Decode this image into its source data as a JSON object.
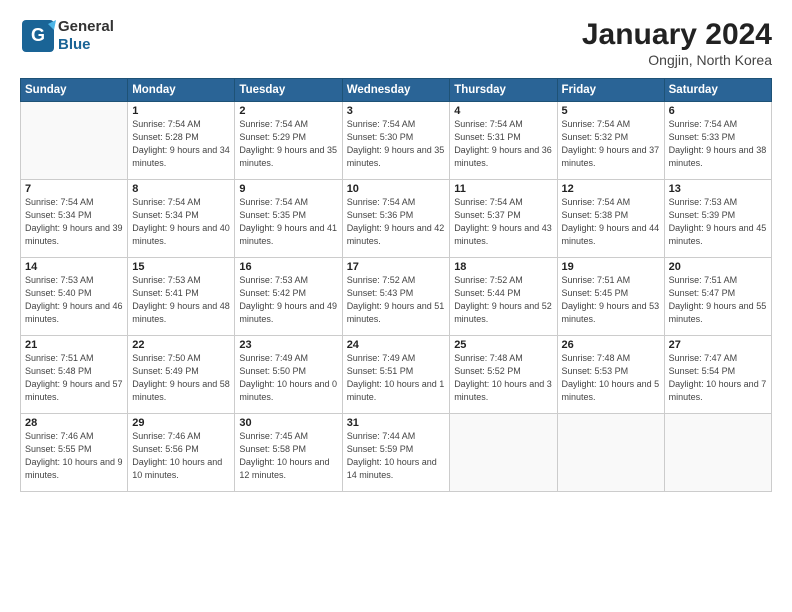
{
  "logo": {
    "general": "General",
    "blue": "Blue"
  },
  "title": {
    "month": "January 2024",
    "location": "Ongjin, North Korea"
  },
  "weekdays": [
    "Sunday",
    "Monday",
    "Tuesday",
    "Wednesday",
    "Thursday",
    "Friday",
    "Saturday"
  ],
  "weeks": [
    [
      {
        "day": "",
        "sunrise": "",
        "sunset": "",
        "daylight": ""
      },
      {
        "day": "1",
        "sunrise": "Sunrise: 7:54 AM",
        "sunset": "Sunset: 5:28 PM",
        "daylight": "Daylight: 9 hours and 34 minutes."
      },
      {
        "day": "2",
        "sunrise": "Sunrise: 7:54 AM",
        "sunset": "Sunset: 5:29 PM",
        "daylight": "Daylight: 9 hours and 35 minutes."
      },
      {
        "day": "3",
        "sunrise": "Sunrise: 7:54 AM",
        "sunset": "Sunset: 5:30 PM",
        "daylight": "Daylight: 9 hours and 35 minutes."
      },
      {
        "day": "4",
        "sunrise": "Sunrise: 7:54 AM",
        "sunset": "Sunset: 5:31 PM",
        "daylight": "Daylight: 9 hours and 36 minutes."
      },
      {
        "day": "5",
        "sunrise": "Sunrise: 7:54 AM",
        "sunset": "Sunset: 5:32 PM",
        "daylight": "Daylight: 9 hours and 37 minutes."
      },
      {
        "day": "6",
        "sunrise": "Sunrise: 7:54 AM",
        "sunset": "Sunset: 5:33 PM",
        "daylight": "Daylight: 9 hours and 38 minutes."
      }
    ],
    [
      {
        "day": "7",
        "sunrise": "Sunrise: 7:54 AM",
        "sunset": "Sunset: 5:34 PM",
        "daylight": "Daylight: 9 hours and 39 minutes."
      },
      {
        "day": "8",
        "sunrise": "Sunrise: 7:54 AM",
        "sunset": "Sunset: 5:34 PM",
        "daylight": "Daylight: 9 hours and 40 minutes."
      },
      {
        "day": "9",
        "sunrise": "Sunrise: 7:54 AM",
        "sunset": "Sunset: 5:35 PM",
        "daylight": "Daylight: 9 hours and 41 minutes."
      },
      {
        "day": "10",
        "sunrise": "Sunrise: 7:54 AM",
        "sunset": "Sunset: 5:36 PM",
        "daylight": "Daylight: 9 hours and 42 minutes."
      },
      {
        "day": "11",
        "sunrise": "Sunrise: 7:54 AM",
        "sunset": "Sunset: 5:37 PM",
        "daylight": "Daylight: 9 hours and 43 minutes."
      },
      {
        "day": "12",
        "sunrise": "Sunrise: 7:54 AM",
        "sunset": "Sunset: 5:38 PM",
        "daylight": "Daylight: 9 hours and 44 minutes."
      },
      {
        "day": "13",
        "sunrise": "Sunrise: 7:53 AM",
        "sunset": "Sunset: 5:39 PM",
        "daylight": "Daylight: 9 hours and 45 minutes."
      }
    ],
    [
      {
        "day": "14",
        "sunrise": "Sunrise: 7:53 AM",
        "sunset": "Sunset: 5:40 PM",
        "daylight": "Daylight: 9 hours and 46 minutes."
      },
      {
        "day": "15",
        "sunrise": "Sunrise: 7:53 AM",
        "sunset": "Sunset: 5:41 PM",
        "daylight": "Daylight: 9 hours and 48 minutes."
      },
      {
        "day": "16",
        "sunrise": "Sunrise: 7:53 AM",
        "sunset": "Sunset: 5:42 PM",
        "daylight": "Daylight: 9 hours and 49 minutes."
      },
      {
        "day": "17",
        "sunrise": "Sunrise: 7:52 AM",
        "sunset": "Sunset: 5:43 PM",
        "daylight": "Daylight: 9 hours and 51 minutes."
      },
      {
        "day": "18",
        "sunrise": "Sunrise: 7:52 AM",
        "sunset": "Sunset: 5:44 PM",
        "daylight": "Daylight: 9 hours and 52 minutes."
      },
      {
        "day": "19",
        "sunrise": "Sunrise: 7:51 AM",
        "sunset": "Sunset: 5:45 PM",
        "daylight": "Daylight: 9 hours and 53 minutes."
      },
      {
        "day": "20",
        "sunrise": "Sunrise: 7:51 AM",
        "sunset": "Sunset: 5:47 PM",
        "daylight": "Daylight: 9 hours and 55 minutes."
      }
    ],
    [
      {
        "day": "21",
        "sunrise": "Sunrise: 7:51 AM",
        "sunset": "Sunset: 5:48 PM",
        "daylight": "Daylight: 9 hours and 57 minutes."
      },
      {
        "day": "22",
        "sunrise": "Sunrise: 7:50 AM",
        "sunset": "Sunset: 5:49 PM",
        "daylight": "Daylight: 9 hours and 58 minutes."
      },
      {
        "day": "23",
        "sunrise": "Sunrise: 7:49 AM",
        "sunset": "Sunset: 5:50 PM",
        "daylight": "Daylight: 10 hours and 0 minutes."
      },
      {
        "day": "24",
        "sunrise": "Sunrise: 7:49 AM",
        "sunset": "Sunset: 5:51 PM",
        "daylight": "Daylight: 10 hours and 1 minute."
      },
      {
        "day": "25",
        "sunrise": "Sunrise: 7:48 AM",
        "sunset": "Sunset: 5:52 PM",
        "daylight": "Daylight: 10 hours and 3 minutes."
      },
      {
        "day": "26",
        "sunrise": "Sunrise: 7:48 AM",
        "sunset": "Sunset: 5:53 PM",
        "daylight": "Daylight: 10 hours and 5 minutes."
      },
      {
        "day": "27",
        "sunrise": "Sunrise: 7:47 AM",
        "sunset": "Sunset: 5:54 PM",
        "daylight": "Daylight: 10 hours and 7 minutes."
      }
    ],
    [
      {
        "day": "28",
        "sunrise": "Sunrise: 7:46 AM",
        "sunset": "Sunset: 5:55 PM",
        "daylight": "Daylight: 10 hours and 9 minutes."
      },
      {
        "day": "29",
        "sunrise": "Sunrise: 7:46 AM",
        "sunset": "Sunset: 5:56 PM",
        "daylight": "Daylight: 10 hours and 10 minutes."
      },
      {
        "day": "30",
        "sunrise": "Sunrise: 7:45 AM",
        "sunset": "Sunset: 5:58 PM",
        "daylight": "Daylight: 10 hours and 12 minutes."
      },
      {
        "day": "31",
        "sunrise": "Sunrise: 7:44 AM",
        "sunset": "Sunset: 5:59 PM",
        "daylight": "Daylight: 10 hours and 14 minutes."
      },
      {
        "day": "",
        "sunrise": "",
        "sunset": "",
        "daylight": ""
      },
      {
        "day": "",
        "sunrise": "",
        "sunset": "",
        "daylight": ""
      },
      {
        "day": "",
        "sunrise": "",
        "sunset": "",
        "daylight": ""
      }
    ]
  ]
}
